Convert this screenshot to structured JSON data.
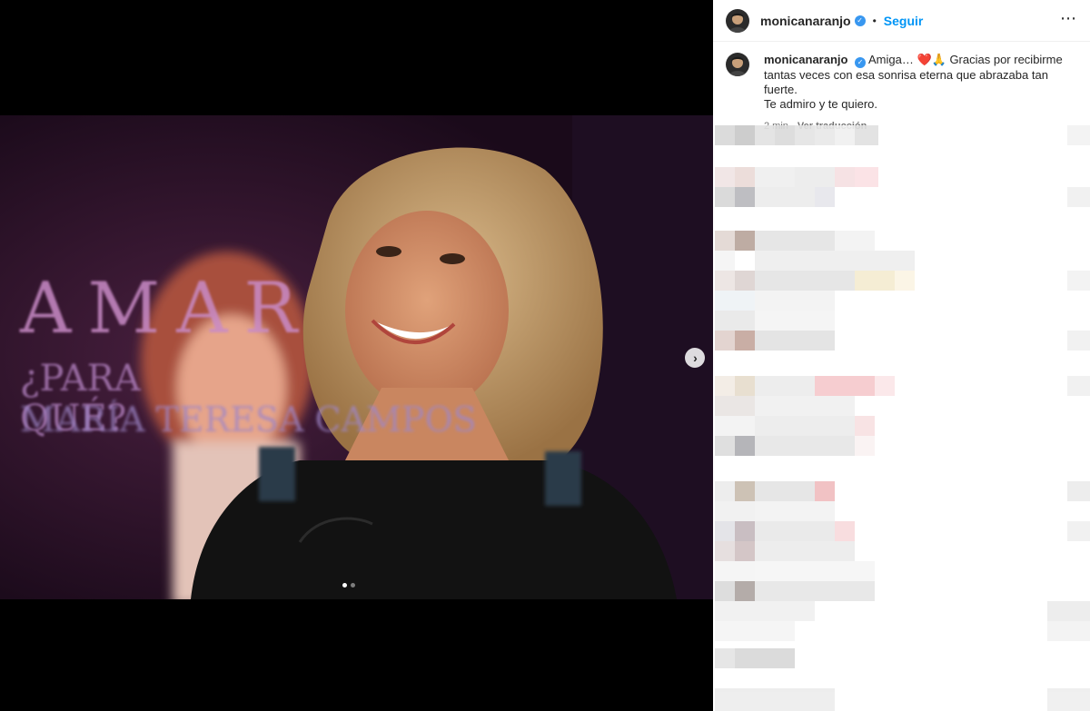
{
  "post": {
    "username": "monicanaranjo",
    "verified_mark": "✓",
    "separator": "•",
    "follow_label": "Seguir",
    "more_icon": "⋯"
  },
  "media": {
    "backdrop_title": "AMAR",
    "backdrop_subtitle": "¿PARA QUÉ?",
    "backdrop_name": "MARÍA TERESA CAMPOS",
    "next_icon": "›",
    "slides_total": 2,
    "current_slide": 1
  },
  "caption": {
    "username": "monicanaranjo",
    "text_line1": "Amiga… ❤️🙏 Gracias por recibirme tantas veces con esa sonrisa eterna que abrazaba tan fuerte.",
    "text_line2": "Te admiro y te quiero.",
    "time": "2 min",
    "translate_label": "Ver traducción"
  },
  "icons": {
    "verified": "verified-badge-icon",
    "more": "more-options-icon",
    "next": "chevron-right-icon"
  },
  "colors": {
    "accent": "#0095f6",
    "verified": "#3897f0",
    "muted": "#737373"
  }
}
